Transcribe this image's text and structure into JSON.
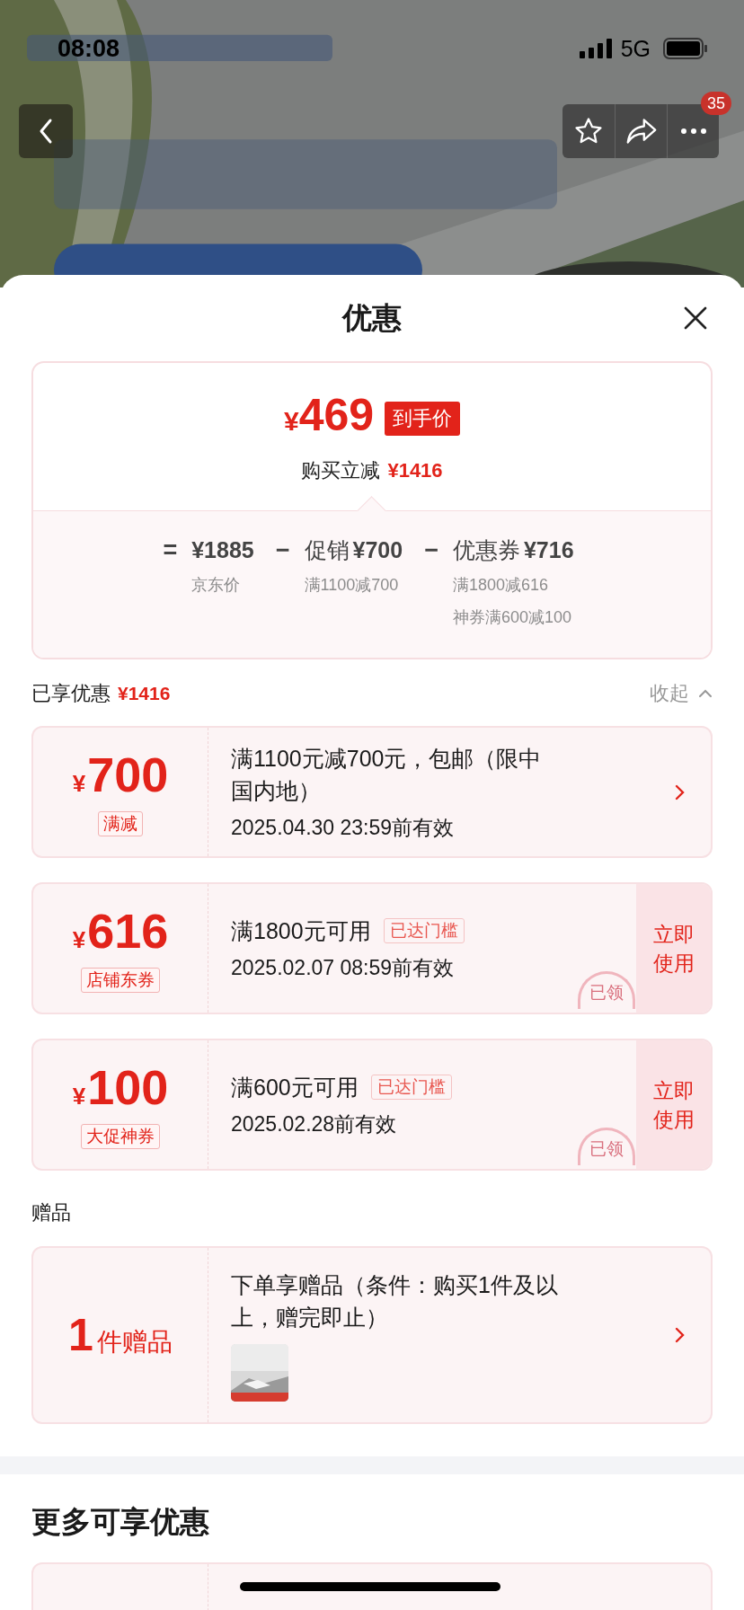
{
  "status_bar": {
    "time": "08:08",
    "network": "5G"
  },
  "nav": {
    "badge": "35"
  },
  "sheet": {
    "title": "优惠"
  },
  "price_summary": {
    "currency": "¥",
    "final_price": "469",
    "final_label": "到手价",
    "saving_label": "购买立减",
    "saving": "¥1416",
    "breakdown": [
      {
        "operator": "=",
        "amount": "¥1885",
        "notes": [
          "京东价"
        ]
      },
      {
        "operator": "−",
        "label": "促销",
        "amount": "¥700",
        "notes": [
          "满1100减700"
        ]
      },
      {
        "operator": "−",
        "label": "优惠券",
        "amount": "¥716",
        "notes": [
          "满1800减616",
          "神券满600减100"
        ]
      }
    ]
  },
  "enjoyed": {
    "label": "已享优惠",
    "amount": "¥1416",
    "collapse": "收起"
  },
  "coupons": [
    {
      "kind": "discount",
      "currency": "¥",
      "amount": "700",
      "tag": "满减",
      "title": "满1100元减700元，包邮（限中国内地）",
      "validity": "2025.04.30 23:59前有效"
    },
    {
      "kind": "coupon",
      "currency": "¥",
      "amount": "616",
      "tag": "店铺东券",
      "title": "满1800元可用",
      "status": "已达门槛",
      "validity": "2025.02.07 08:59前有效",
      "action": "立即使用",
      "stamp": "已领"
    },
    {
      "kind": "coupon",
      "currency": "¥",
      "amount": "100",
      "tag": "大促神券",
      "title": "满600元可用",
      "status": "已达门槛",
      "validity": "2025.02.28前有效",
      "action": "立即使用",
      "stamp": "已领"
    }
  ],
  "gifts": {
    "section_title": "赠品",
    "count": "1",
    "unit": "件赠品",
    "title": "下单享赠品（条件：购买1件及以上，赠完即止）"
  },
  "more": {
    "title": "更多可享优惠"
  }
}
